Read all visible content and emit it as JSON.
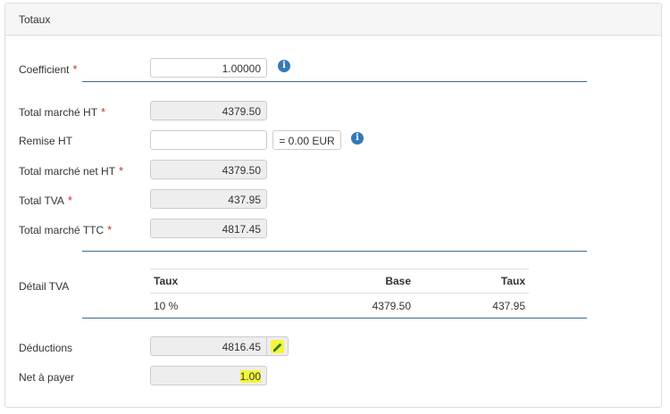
{
  "panel": {
    "title": "Totaux"
  },
  "fields": {
    "coefficient": {
      "label": "Coefficient",
      "required": "*",
      "value": "1.00000"
    },
    "total_ht": {
      "label": "Total marché HT",
      "required": "*",
      "value": "4379.50"
    },
    "remise_ht": {
      "label": "Remise HT",
      "value": "",
      "suffix": "= 0.00 EUR"
    },
    "total_net_ht": {
      "label": "Total marché net HT",
      "required": "*",
      "value": "4379.50"
    },
    "total_tva": {
      "label": "Total TVA",
      "required": "*",
      "value": "437.95"
    },
    "total_ttc": {
      "label": "Total marché TTC",
      "required": "*",
      "value": "4817.45"
    },
    "deductions": {
      "label": "Déductions",
      "value": "4816.45"
    },
    "net_a_payer": {
      "label": "Net à payer",
      "value": "1.00"
    }
  },
  "detail_tva": {
    "label": "Détail TVA",
    "headers": [
      "Taux",
      "Base",
      "Taux"
    ],
    "rows": [
      [
        "10 %",
        "4379.50",
        "437.95"
      ]
    ]
  },
  "icons": {
    "info": "info-icon",
    "edit": "pencil-icon"
  },
  "colors": {
    "required": "#c9302c",
    "info": "#337ab7",
    "separator": "#3d6a8f",
    "highlight": "#f5f53a"
  }
}
